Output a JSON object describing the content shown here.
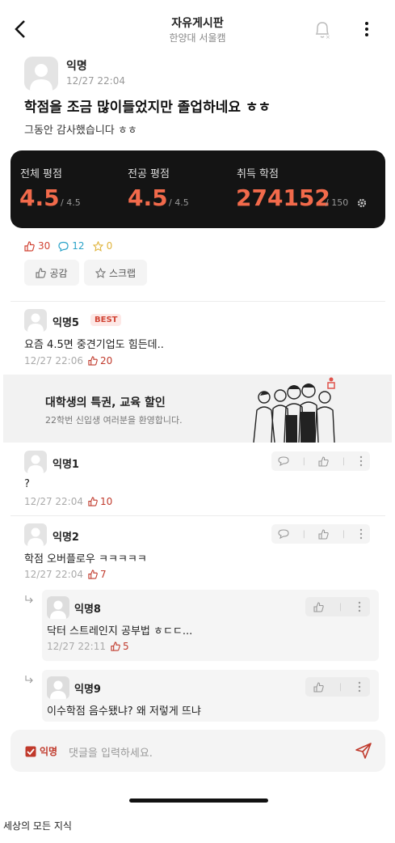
{
  "header": {
    "title": "자유게시판",
    "subtitle": "한양대 서울캠"
  },
  "post": {
    "author": "익명",
    "time": "12/27 22:04",
    "title": "학점을 조금 많이들었지만 졸업하네요 ㅎㅎ",
    "body": "그동안 감사했습니다 ㅎㅎ"
  },
  "grades": [
    {
      "label": "전체 평점",
      "value": "4.5",
      "max": "/ 4.5"
    },
    {
      "label": "전공 평점",
      "value": "4.5",
      "max": "/ 4.5"
    },
    {
      "label": "취득 학점",
      "value": "274152",
      "max": "/ 150"
    }
  ],
  "stats": {
    "likes": "30",
    "comments": "12",
    "scraps": "0"
  },
  "buttons": {
    "like": "공감",
    "scrap": "스크랩"
  },
  "comments": [
    {
      "author": "익명5",
      "badge": "BEST",
      "text": "요즘 4.5면 중견기업도 힘든데..",
      "time": "12/27 22:06",
      "likes": "20"
    },
    {
      "author": "익명1",
      "text": "?",
      "time": "12/27 22:04",
      "likes": "10"
    },
    {
      "author": "익명2",
      "text": "학점 오버플로우 ㅋㅋㅋㅋㅋ",
      "time": "12/27 22:04",
      "likes": "7"
    }
  ],
  "replies": [
    {
      "author": "익명8",
      "text": "닥터 스트레인지 공부법 ㅎㄷㄷ...",
      "time": "12/27 22:11",
      "likes": "5"
    },
    {
      "author": "익명9",
      "text": "이수학점 음수됐냐? 왜 저렇게 뜨냐"
    }
  ],
  "ad": {
    "title": "대학생의 특권, 교육 할인",
    "subtitle": "22학번 신입생 여러분을 환영합니다."
  },
  "input": {
    "anon_label": "익명",
    "placeholder": "댓글을 입력하세요."
  },
  "caption": "세상의 모든 지식",
  "colors": {
    "accent": "#c0392b",
    "grade": "#f26a4b",
    "card": "#141414"
  }
}
